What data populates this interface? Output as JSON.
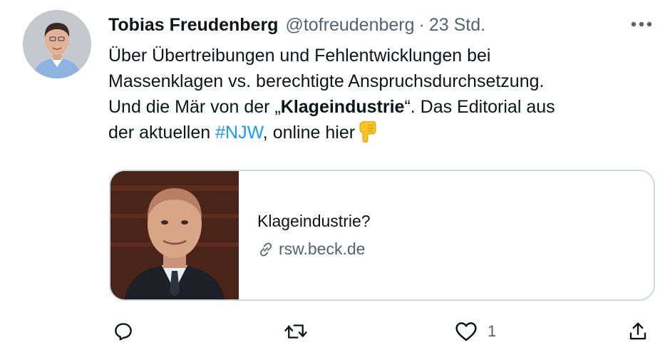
{
  "tweet": {
    "author_name": "Tobias Freudenberg",
    "handle": "@tofreudenberg",
    "separator": "·",
    "time": "23 Std.",
    "text": {
      "line1": "Über Übertreibungen und Fehlentwicklungen bei",
      "line2": "Massenklagen vs. berechtigte Anspruchsdurchsetzung.",
      "line3_pre": "Und die Mär von der „",
      "line3_bold": "Klageindustrie",
      "line3_post": "“. Das Editorial aus",
      "line4_pre": "der aktuellen ",
      "hashtag": "#NJW",
      "line4_post": ", online hier"
    },
    "emoji": "pointing-down-emoji"
  },
  "card": {
    "title": "Klageindustrie?",
    "domain": "rsw.beck.de"
  },
  "actions": {
    "reply_icon": "reply-icon",
    "retweet_icon": "retweet-icon",
    "like_icon": "heart-icon",
    "like_count": "1",
    "share_icon": "share-icon"
  },
  "colors": {
    "text": "#0f1419",
    "secondary": "#536471",
    "link": "#1d9bf0",
    "border": "#cfd9de"
  }
}
